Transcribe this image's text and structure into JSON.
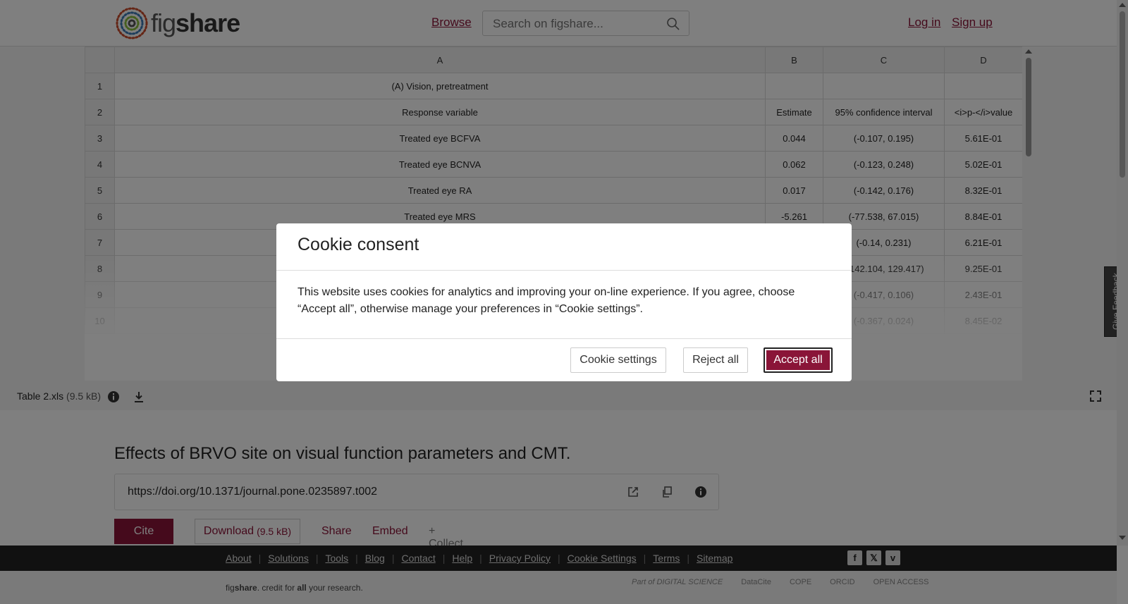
{
  "header": {
    "logo_text_light": "fig",
    "logo_text_bold": "share",
    "browse": "Browse",
    "search_placeholder": "Search on figshare...",
    "login": "Log in",
    "signup": "Sign up"
  },
  "sheet": {
    "columns": [
      "A",
      "B",
      "C",
      "D"
    ],
    "rows": [
      {
        "n": "1",
        "a": "(A) Vision, pretreatment",
        "b": "",
        "c": "",
        "d": ""
      },
      {
        "n": "2",
        "a": "Response variable",
        "b": "Estimate",
        "c": "95% confidence interval",
        "d": "<i>p-</i>value"
      },
      {
        "n": "3",
        "a": "Treated eye BCFVA",
        "b": "0.044",
        "c": "(-0.107, 0.195)",
        "d": "5.61E-01"
      },
      {
        "n": "4",
        "a": "Treated eye BCNVA",
        "b": "0.062",
        "c": "(-0.123, 0.248)",
        "d": "5.02E-01"
      },
      {
        "n": "5",
        "a": "Treated eye RA",
        "b": "0.017",
        "c": "(-0.142, 0.176)",
        "d": "8.32E-01"
      },
      {
        "n": "6",
        "a": "Treated eye MRS",
        "b": "-5.261",
        "c": "(-77.538, 67.015)",
        "d": "8.84E-01"
      },
      {
        "n": "7",
        "a": "",
        "b": "",
        "c": "(-0.14, 0.231)",
        "d": "6.21E-01"
      },
      {
        "n": "8",
        "a": "",
        "b": "",
        "c": "(-142.104, 129.417)",
        "d": "9.25E-01"
      },
      {
        "n": "9",
        "a": "",
        "b": "",
        "c": "(-0.417, 0.106)",
        "d": "2.43E-01"
      },
      {
        "n": "10",
        "a": "",
        "b": "",
        "c": "(-0.367, 0.024)",
        "d": "8.45E-02"
      }
    ]
  },
  "file": {
    "name": "Table 2.xls",
    "size": "(9.5 kB)"
  },
  "feedback": "Give Feedback",
  "article": {
    "title": "Effects of BRVO site on visual function parameters and CMT.",
    "doi": "https://doi.org/10.1371/journal.pone.0235897.t002",
    "cite": "Cite",
    "download": "Download",
    "download_size": "(9.5 kB)",
    "share": "Share",
    "embed": "Embed",
    "collect": "+ Collect"
  },
  "footer": {
    "links": [
      "About",
      "Solutions",
      "Tools",
      "Blog",
      "Contact",
      "Help",
      "Privacy Policy",
      "Cookie Settings",
      "Terms",
      "Sitemap"
    ],
    "tagline_fig": "fig",
    "tagline_share": "share",
    "tagline_rest1": ". credit for ",
    "tagline_all": "all",
    "tagline_rest2": " your research.",
    "partners": [
      "Part of DIGITAL SCIENCE",
      "DataCite",
      "COPE",
      "ORCID",
      "OPEN ACCESS"
    ]
  },
  "cookie": {
    "title": "Cookie consent",
    "body": "This website uses cookies for analytics and improving your on-line experience. If you agree, choose “Accept all”, otherwise manage your preferences in “Cookie settings”.",
    "settings": "Cookie settings",
    "reject": "Reject all",
    "accept": "Accept all"
  },
  "colors": {
    "brand": "#8a1538",
    "overlay": "rgba(0,0,0,0.5)"
  }
}
